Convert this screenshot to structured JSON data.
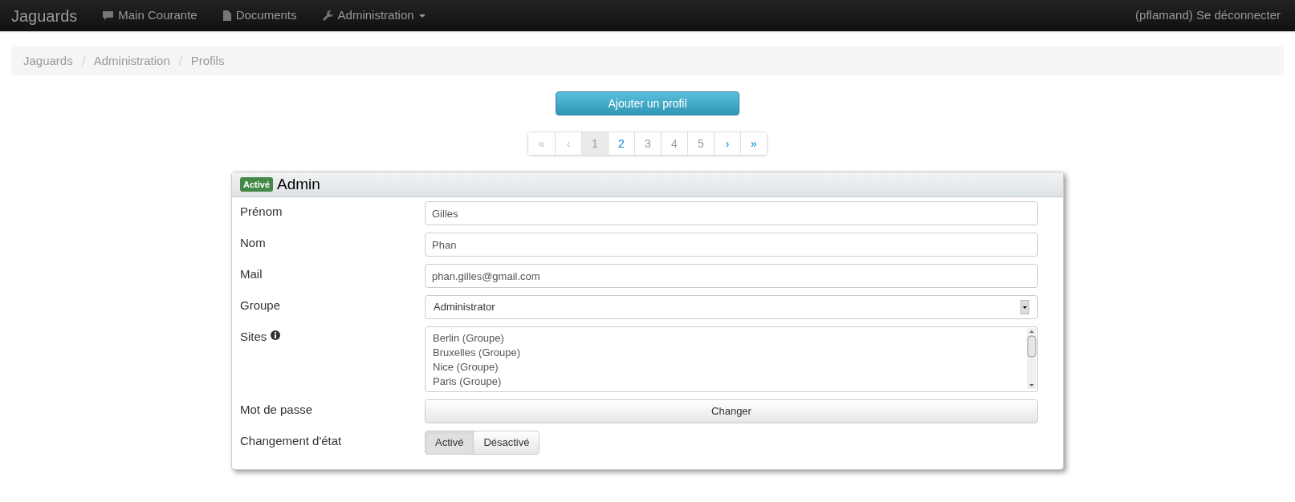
{
  "navbar": {
    "brand": "Jaguards",
    "items": [
      {
        "label": "Main Courante",
        "dropdown": false
      },
      {
        "label": "Documents",
        "dropdown": false
      },
      {
        "label": "Administration",
        "dropdown": true
      }
    ],
    "user": "(pflamand) Se déconnecter"
  },
  "breadcrumb": [
    "Jaguards",
    "Administration",
    "Profils"
  ],
  "add_button": "Ajouter un profil",
  "pagination": [
    {
      "label": "«",
      "kind": "disabled",
      "selected": false
    },
    {
      "label": "‹",
      "kind": "disabled",
      "selected": false
    },
    {
      "label": "1",
      "kind": "plain",
      "selected": true
    },
    {
      "label": "2",
      "kind": "link",
      "selected": false
    },
    {
      "label": "3",
      "kind": "plain",
      "selected": false
    },
    {
      "label": "4",
      "kind": "plain",
      "selected": false
    },
    {
      "label": "5",
      "kind": "plain",
      "selected": false
    },
    {
      "label": "›",
      "kind": "link",
      "selected": false
    },
    {
      "label": "»",
      "kind": "link",
      "selected": false
    }
  ],
  "profile": {
    "badge": "Activé",
    "active": true,
    "title": "Admin",
    "fields": [
      {
        "kind": "text",
        "label": "Prénom",
        "value": "Gilles"
      },
      {
        "kind": "text",
        "label": "Nom",
        "value": "Phan"
      },
      {
        "kind": "text",
        "label": "Mail",
        "value": "phan.gilles@gmail.com"
      },
      {
        "kind": "select",
        "label": "Groupe",
        "value": "Administrator"
      },
      {
        "kind": "list",
        "label": "Sites",
        "info": true,
        "options": [
          "Berlin (Groupe)",
          "Bruxelles (Groupe)",
          "Nice (Groupe)",
          "Paris (Groupe)"
        ]
      },
      {
        "kind": "button",
        "label": "Mot de passe",
        "value": "Changer"
      },
      {
        "kind": "toggle",
        "label": "Changement d'état",
        "options": [
          {
            "label": "Activé",
            "selected": true
          },
          {
            "label": "Désactivé",
            "selected": false
          }
        ]
      }
    ]
  }
}
